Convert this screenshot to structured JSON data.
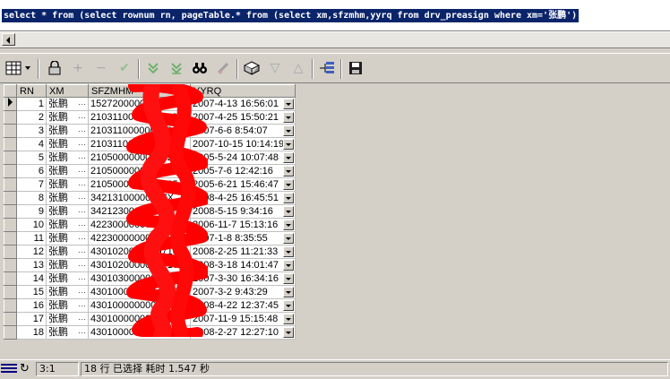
{
  "editor": {
    "sql": "select * from (select rownum rn, pageTable.* from (select xm,sfzmhm,yyrq from drv_preasign where xm='张鹏')"
  },
  "toolbar": {
    "buttons": [
      {
        "name": "grid-view-icon"
      },
      {
        "name": "lock-icon"
      },
      {
        "name": "add-record-icon"
      },
      {
        "name": "delete-record-icon"
      },
      {
        "name": "post-changes-icon"
      },
      {
        "name": "fetch-next-icon"
      },
      {
        "name": "fetch-all-icon"
      },
      {
        "name": "find-icon"
      },
      {
        "name": "clear-filter-icon"
      },
      {
        "name": "query-by-example-icon"
      },
      {
        "name": "next-record-icon"
      },
      {
        "name": "previous-record-icon"
      },
      {
        "name": "explain-plan-icon"
      },
      {
        "name": "save-icon"
      }
    ]
  },
  "grid": {
    "columns": [
      "RN",
      "XM",
      "SFZMHM",
      "YYRQ"
    ],
    "rows": [
      {
        "rn": "1",
        "xm": "张鹏",
        "sfz": "1527200000000018",
        "yyrq": "2007-4-13 16:56:01"
      },
      {
        "rn": "2",
        "xm": "张鹏",
        "sfz": "2103110000000039",
        "yyrq": "2007-4-25 15:50:21"
      },
      {
        "rn": "3",
        "xm": "张鹏",
        "sfz": "2103110000000039",
        "yyrq": "2007-6-6 8:54:07"
      },
      {
        "rn": "4",
        "xm": "张鹏",
        "sfz": "2103110000000039",
        "yyrq": "2007-10-15 10:14:19"
      },
      {
        "rn": "5",
        "xm": "张鹏",
        "sfz": "2105000000000625",
        "yyrq": "2005-5-24 10:07:48"
      },
      {
        "rn": "6",
        "xm": "张鹏",
        "sfz": "2105000000000625",
        "yyrq": "2005-7-6 12:42:16"
      },
      {
        "rn": "7",
        "xm": "张鹏",
        "sfz": "2105000000000625",
        "yyrq": "2005-6-21 15:46:47"
      },
      {
        "rn": "8",
        "xm": "张鹏",
        "sfz": "34213100000097X",
        "yyrq": "2008-4-25 16:45:51"
      },
      {
        "rn": "9",
        "xm": "张鹏",
        "sfz": "34212300000097X",
        "yyrq": "2008-5-15 9:34:16"
      },
      {
        "rn": "10",
        "xm": "张鹏",
        "sfz": "4223000000001232",
        "yyrq": "2006-11-7 15:13:16"
      },
      {
        "rn": "11",
        "xm": "张鹏",
        "sfz": "4223000000001232",
        "yyrq": "2007-1-8 8:35:55"
      },
      {
        "rn": "12",
        "xm": "张鹏",
        "sfz": "4301020000000710",
        "yyrq": "2008-2-25 11:21:33"
      },
      {
        "rn": "13",
        "xm": "张鹏",
        "sfz": "4301020000000710",
        "yyrq": "2008-3-18 14:01:47"
      },
      {
        "rn": "14",
        "xm": "张鹏",
        "sfz": "4301030000004036",
        "yyrq": "2007-3-30 16:34:16"
      },
      {
        "rn": "15",
        "xm": "张鹏",
        "sfz": "4301000000004036",
        "yyrq": "2007-3-2 9:43:29"
      },
      {
        "rn": "16",
        "xm": "张鹏",
        "sfz": "4301000000004036",
        "yyrq": "2008-4-22 12:37:45"
      },
      {
        "rn": "17",
        "xm": "张鹏",
        "sfz": "4301000000000448",
        "yyrq": "2007-11-9 15:15:48"
      },
      {
        "rn": "18",
        "xm": "张鹏",
        "sfz": "4301000000000319",
        "yyrq": "2008-2-27 12:27:10"
      }
    ]
  },
  "status": {
    "cursor_pos": "3:1",
    "message": "18 行 已选择 耗时 1.547 秒"
  },
  "colors": {
    "selection": "#0a246a",
    "chrome": "#d4d0c8",
    "redaction": "#ff0000"
  }
}
